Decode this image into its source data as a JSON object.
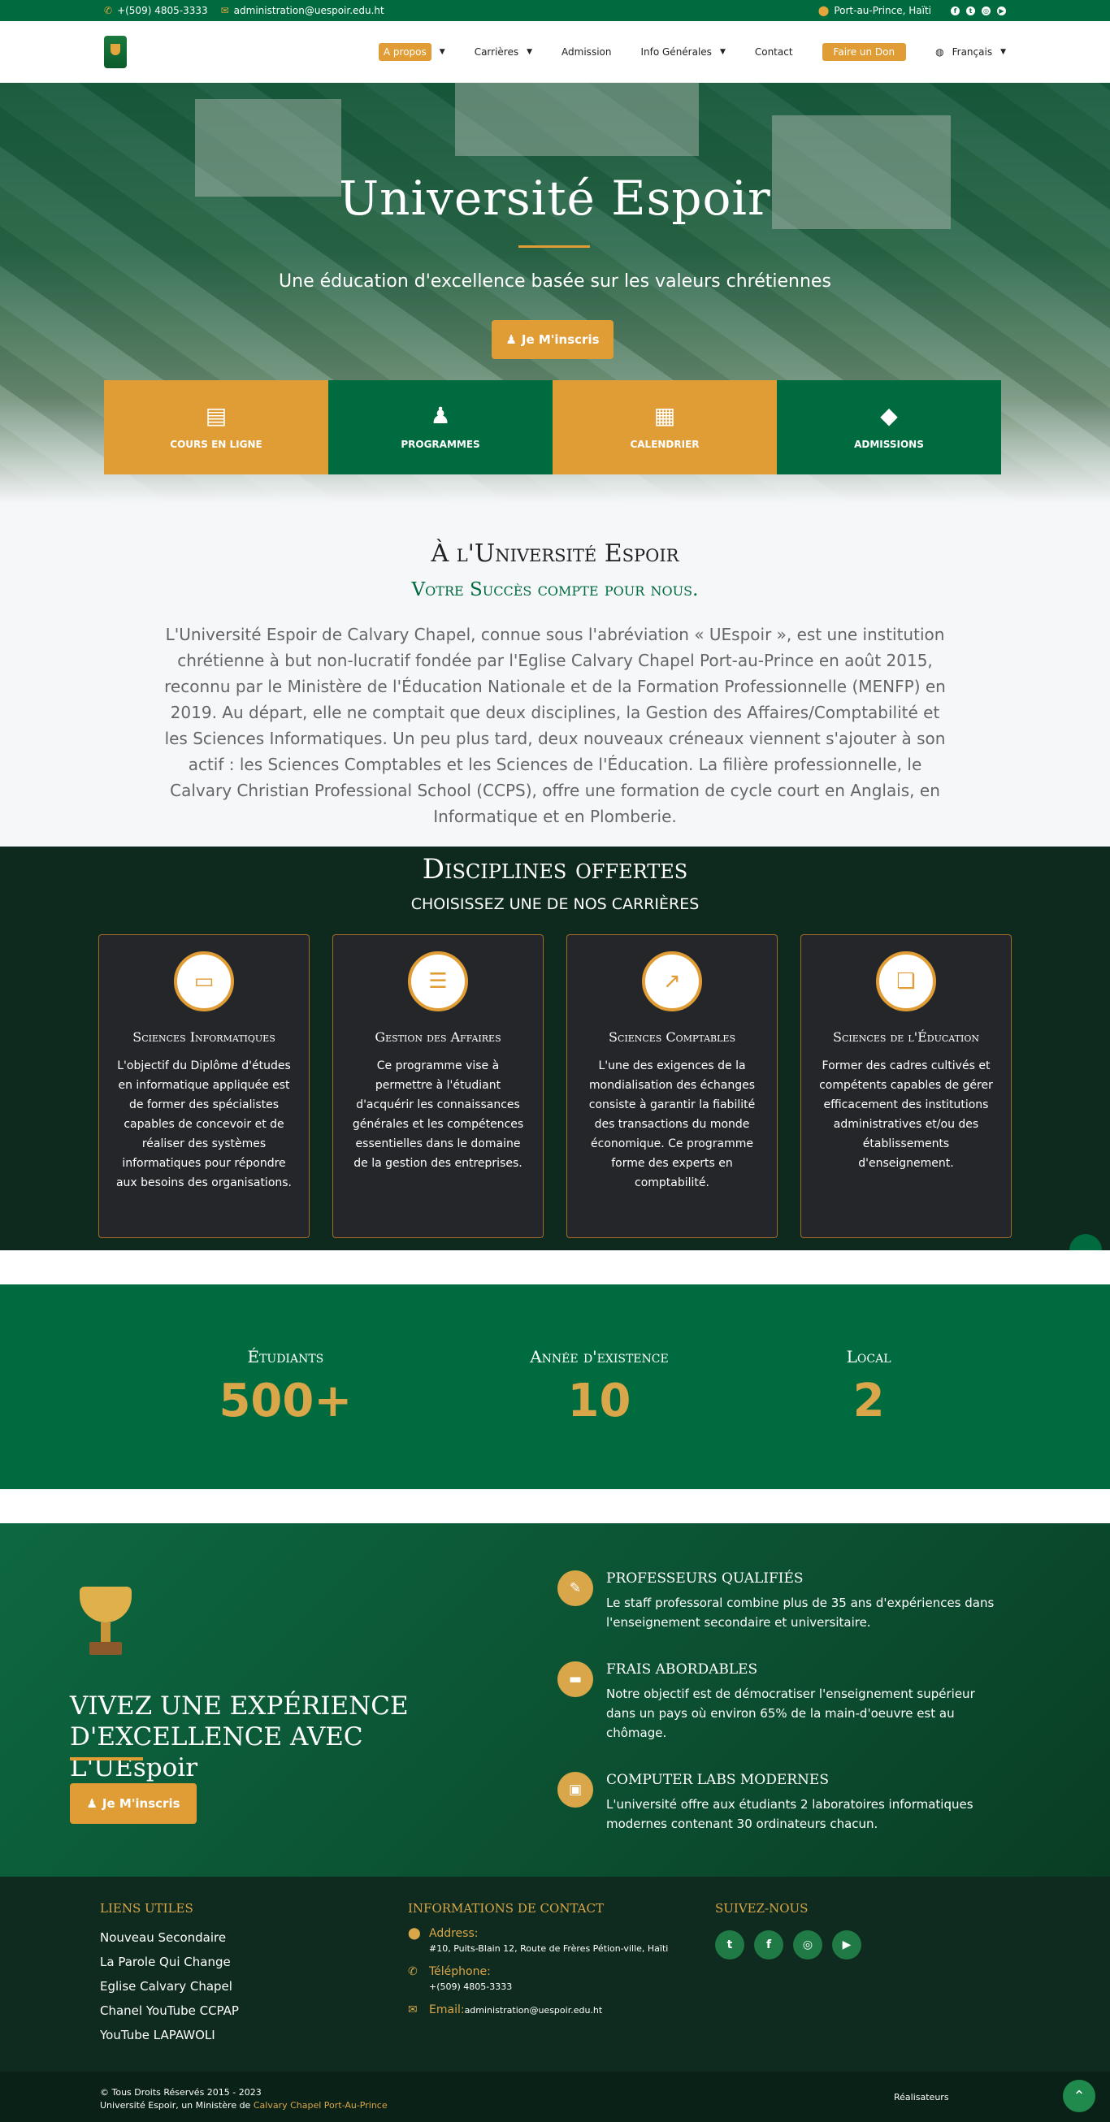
{
  "topbar": {
    "phone": "+(509) 4805-3333",
    "email": "administration@uespoir.edu.ht",
    "location": "Port-au-Prince, Haïti"
  },
  "nav": {
    "items": [
      {
        "label": "A propos",
        "active": true,
        "dropdown": true
      },
      {
        "label": "Carrières",
        "dropdown": true
      },
      {
        "label": "Admission"
      },
      {
        "label": "Info Générales",
        "dropdown": true
      },
      {
        "label": "Contact"
      }
    ],
    "donate": "Faire un Don",
    "language": "Français"
  },
  "hero": {
    "title": "Université Espoir",
    "subtitle": "Une éducation d'excellence basée sur les valeurs chrétiennes",
    "cta": "Je M'inscris",
    "tiles": [
      "COURS EN LIGNE",
      "PROGRAMMES",
      "CALENDRIER",
      "ADMISSIONS"
    ]
  },
  "about": {
    "title": "À l'Université Espoir",
    "subtitle": "Votre Succès compte pour nous.",
    "text": "L'Université Espoir de Calvary Chapel, connue sous l'abréviation « UEspoir », est une institution chrétienne à but non-lucratif fondée par l'Eglise Calvary Chapel Port-au-Prince en août 2015, reconnu par le Ministère de l'Éducation Nationale et de la Formation Professionnelle (MENFP) en 2019. Au départ, elle ne comptait que deux disciplines, la Gestion des Affaires/Comptabilité et les Sciences Informatiques. Un peu plus tard, deux nouveaux créneaux viennent s'ajouter à son actif : les Sciences Comptables et les Sciences de l'Éducation. La filière professionnelle, le Calvary Christian Professional School (CCPS), offre une formation de cycle court en Anglais, en Informatique et en Plomberie."
  },
  "disciplines": {
    "title": "Disciplines offertes",
    "subtitle": "CHOISISSEZ UNE DE NOS CARRIÈRES",
    "cards": [
      {
        "title": "Sciences Informatiques",
        "text": "L'objectif du Diplôme d'études en informatique appliquée est de former des spécialistes capables de concevoir et de réaliser des systèmes informatiques pour répondre aux besoins des organisations."
      },
      {
        "title": "Gestion des Affaires",
        "text": "Ce programme vise à permettre à l'étudiant d'acquérir les connaissances générales et les compétences essentielles dans le domaine de la gestion des entreprises."
      },
      {
        "title": "Sciences Comptables",
        "text": "L'une des exigences de la mondialisation des échanges consiste à garantir la fiabilité des transactions du monde économique. Ce programme forme des experts en comptabilité."
      },
      {
        "title": "Sciences de l'Éducation",
        "text": "Former des cadres cultivés et compétents capables de gérer efficacement des institutions administratives et/ou des établissements d'enseignement."
      }
    ]
  },
  "stats": [
    {
      "label": "Étudiants",
      "value": "500+"
    },
    {
      "label": "Année d'existence",
      "value": "10"
    },
    {
      "label": "Local",
      "value": "2"
    }
  ],
  "experience": {
    "title": "VIVEZ UNE EXPÉRIENCE D'EXCELLENCE AVEC L'UEspoir",
    "cta": "Je M'inscris",
    "features": [
      {
        "title": "PROFESSEURS QUALIFIÉS",
        "text": "Le staff professoral combine plus de 35 ans d'expériences dans l'enseignement secondaire et universitaire."
      },
      {
        "title": "FRAIS ABORDABLES",
        "text": "Notre objectif est de démocratiser l'enseignement supérieur dans un pays où environ 65% de la main-d'oeuvre est au chômage."
      },
      {
        "title": "COMPUTER LABS MODERNES",
        "text": "L'université offre aux étudiants 2 laboratoires informatiques modernes contenant 30 ordinateurs chacun."
      }
    ]
  },
  "footer": {
    "links_title": "LIENS UTILES",
    "links": [
      "Nouveau Secondaire",
      "La Parole Qui Change",
      "Eglise Calvary Chapel",
      "Chanel YouTube CCPAP",
      "YouTube LAPAWOLI"
    ],
    "contact_title": "INFORMATIONS DE CONTACT",
    "address_label": "Address:",
    "address": "#10, Puits-Blain 12, Route de Frères Pétion-ville, Haïti",
    "phone_label": "Téléphone:",
    "phone": "+(509) 4805-3333",
    "email_label": "Email:",
    "email": "administration@uespoir.edu.ht",
    "follow_title": "SUIVEZ-NOUS",
    "copyright": "© Tous Droits Réservés 2015 - 2023",
    "ministry_prefix": "Université Espoir, un Ministère de",
    "ministry_link": "Calvary Chapel Port-Au-Prince",
    "credits": "Réalisateurs"
  }
}
